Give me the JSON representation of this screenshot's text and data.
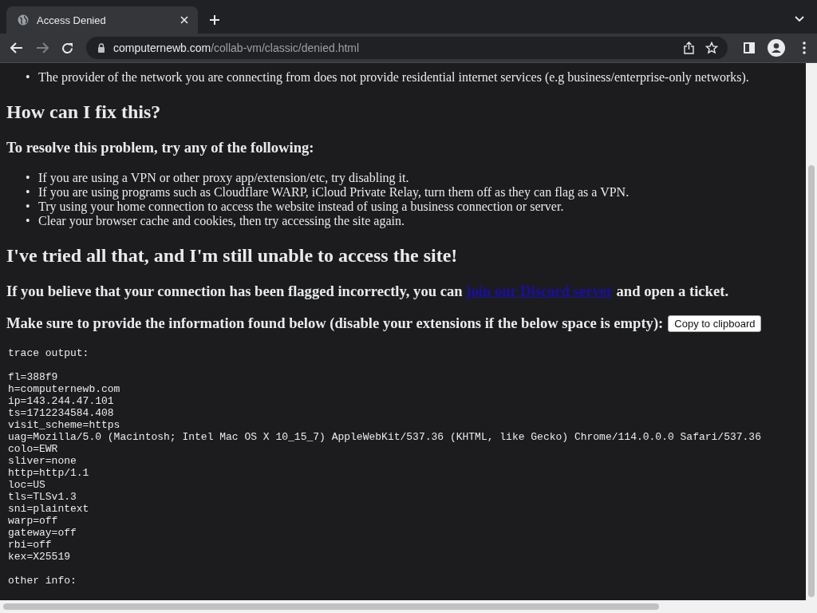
{
  "browser": {
    "tab": {
      "title": "Access Denied",
      "selected": true
    },
    "url": {
      "host": "computernewb.com",
      "path": "/collab-vm/classic/denied.html"
    }
  },
  "page": {
    "reasons": [
      {
        "marker": "•",
        "text": "The provider of the network you are connecting from does not provide residential internet services (e.g business/enterprise-only networks)."
      }
    ],
    "fix_heading": "How can I fix this?",
    "fix_subheading": "To resolve this problem, try any of the following:",
    "fixes": [
      {
        "marker": "•",
        "text": "If you are using a VPN or other proxy app/extension/etc, try disabling it."
      },
      {
        "marker": "•",
        "text": "If you are using programs such as Cloudflare WARP, iCloud Private Relay, turn them off as they can flag as a VPN."
      },
      {
        "marker": "•",
        "text": "Try using your home connection to access the website instead of using a business connection or server."
      },
      {
        "marker": "•",
        "text": "Clear your browser cache and cookies, then try accessing the site again."
      }
    ],
    "tried_heading": "I've tried all that, and I'm still unable to access the site!",
    "contact": {
      "before": "If you believe that your connection has been flagged incorrectly, you can",
      "link": "join our Discord server",
      "after": "and open a ticket."
    },
    "provide": "Make sure to provide the information found below (disable your extensions if the below space is empty):",
    "copy_button": "Copy to clipboard",
    "trace_label": "trace output:",
    "trace": [
      "fl=388f9",
      "h=computernewb.com",
      "ip=143.244.47.101",
      "ts=1712234584.408",
      "visit_scheme=https",
      "uag=Mozilla/5.0 (Macintosh; Intel Mac OS X 10_15_7) AppleWebKit/537.36 (KHTML, like Gecko) Chrome/114.0.0.0 Safari/537.36",
      "colo=EWR",
      "sliver=none",
      "http=http/1.1",
      "loc=US",
      "tls=TLSv1.3",
      "sni=plaintext",
      "warp=off",
      "gateway=off",
      "rbi=off",
      "kex=X25519"
    ],
    "other_label": "other info:"
  }
}
